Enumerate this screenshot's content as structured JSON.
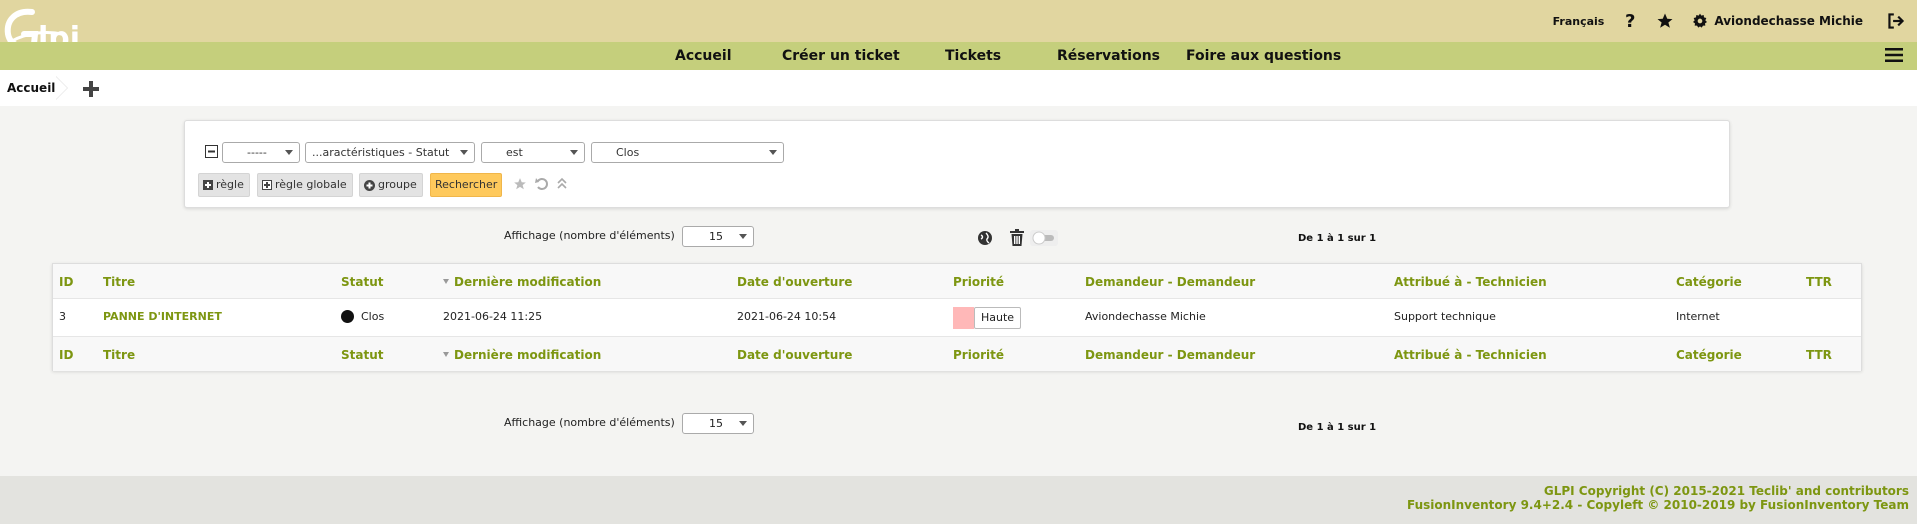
{
  "app": {
    "logo_text": "Glpi"
  },
  "header": {
    "language": "Français",
    "username": "Aviondechasse Michie"
  },
  "nav": {
    "items": [
      "Accueil",
      "Créer un ticket",
      "Tickets",
      "Réservations",
      "Foire aux questions"
    ]
  },
  "breadcrumb": {
    "label": "Accueil"
  },
  "search": {
    "criteria": {
      "link_value": "-----",
      "field_value": "...aractéristiques - Statut",
      "operator_value": "est",
      "value": "Clos"
    },
    "buttons": {
      "rule": "règle",
      "global_rule": "règle globale",
      "group": "groupe",
      "search": "Rechercher"
    }
  },
  "pager": {
    "display_label": "Affichage (nombre d'éléments)",
    "per_page": "15",
    "count_text": "De 1 à 1 sur 1"
  },
  "table": {
    "columns": [
      "ID",
      "Titre",
      "Statut",
      "Dernière modification",
      "Date d'ouverture",
      "Priorité",
      "Demandeur - Demandeur",
      "Attribué à - Technicien",
      "Catégorie",
      "TTR"
    ],
    "sorted_column": "Dernière modification",
    "rows": [
      {
        "id": "3",
        "title": "PANNE D'INTERNET",
        "status": "Clos",
        "last_modified": "2021-06-24 11:25",
        "opened": "2021-06-24 10:54",
        "priority": "Haute",
        "requester": "Aviondechasse Michie",
        "technician": "Support technique",
        "category": "Internet",
        "ttr": ""
      }
    ]
  },
  "footer": {
    "line1": "GLPI Copyright (C) 2015-2021 Teclib' and contributors",
    "line2": "FusionInventory 9.4+2.4 - Copyleft © 2010-2019 by FusionInventory Team"
  },
  "colors": {
    "topbar": "#e1d6a0",
    "navbar": "#c5cf7c",
    "link_green": "#7d9611",
    "search_button": "#fec95c",
    "priority_high": "#ffb8b8"
  }
}
